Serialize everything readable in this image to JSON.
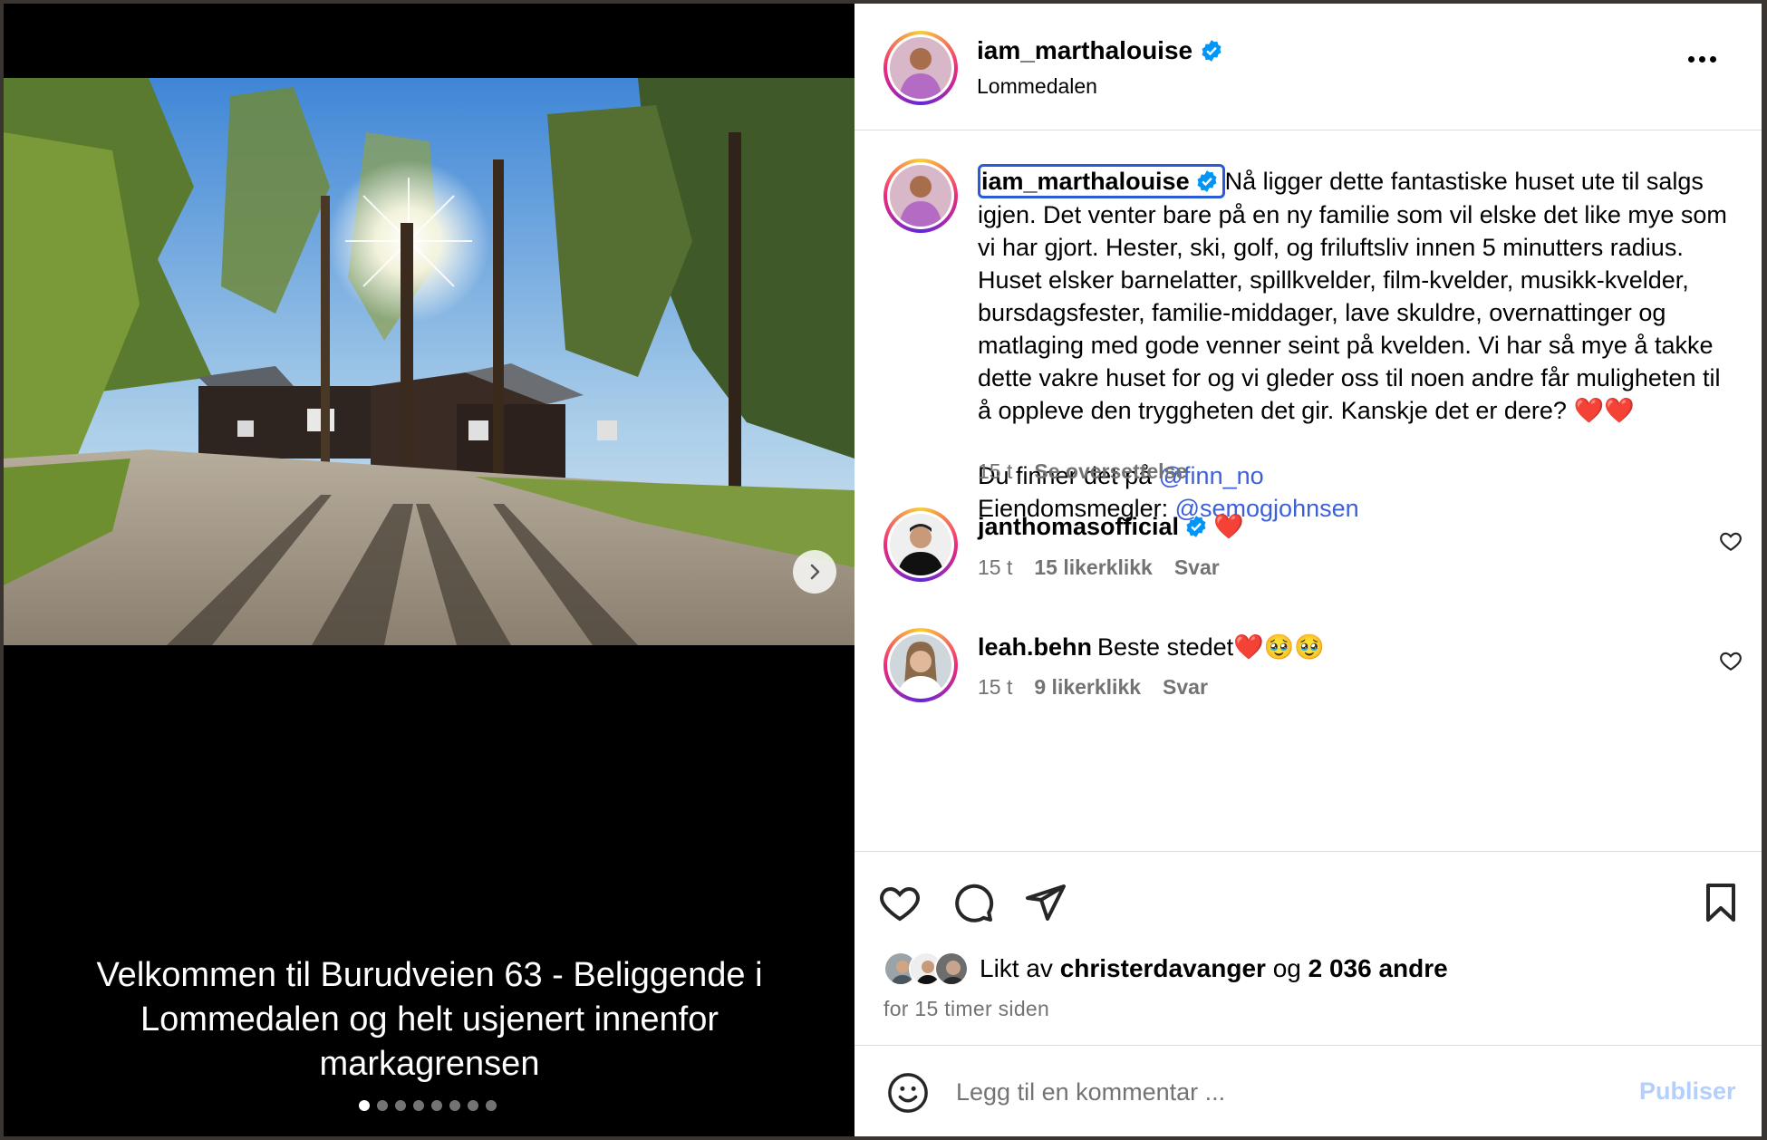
{
  "post": {
    "author": "iam_marthalouise",
    "location": "Lommedalen",
    "caption_body": "Nå ligger dette fantastiske huset ute til salgs igjen. Det venter bare på en ny familie som vil elske det like mye som vi har gjort. Hester, ski, golf, og friluftsliv innen 5 minutters radius. Huset elsker barnelatter, spillkvelder, film-kvelder, musikk-kvelder, bursdagsfester, familie-middager, lave skuldre, overnattinger og matlaging med gode venner seint på kvelden. Vi har så mye å takke dette vakre huset for og vi gleder oss til noen andre får muligheten til å oppleve den tryggheten det gir. Kanskje det er dere? ❤️❤️",
    "finn_prefix": "Du finner det på ",
    "finn_link": "@finn_no",
    "broker_prefix": "Eiendomsmegler: ",
    "broker_link": "@semogjohnsen",
    "caption_time": "15 t",
    "translate_label": "Se oversettelse"
  },
  "media": {
    "caption_lines": [
      "Velkommen til Burudveien 63 -  Beliggende i",
      "Lommedalen og helt usjenert innenfor",
      "markagrensen"
    ],
    "slide_count": 8,
    "active_slide": 1
  },
  "comments": [
    {
      "user": "janthomasofficial",
      "verified": true,
      "text": "❤️",
      "time": "15 t",
      "likes": "15 likerklikk",
      "reply": "Svar"
    },
    {
      "user": "leah.behn",
      "verified": false,
      "text": "Beste stedet❤️🥹🥹",
      "time": "15 t",
      "likes": "9 likerklikk",
      "reply": "Svar"
    }
  ],
  "likes": {
    "prefix": "Likt av ",
    "user": "christerdavanger",
    "middle": " og ",
    "others": "2 036 andre",
    "time_ago": "for 15 timer siden"
  },
  "composer": {
    "placeholder": "Legg til en kommentar ...",
    "publish_label": "Publiser"
  },
  "colors": {
    "link": "#3d5fd9",
    "verified": "#0095f6",
    "muted": "#737373",
    "publish_disabled": "#b2cffd"
  }
}
